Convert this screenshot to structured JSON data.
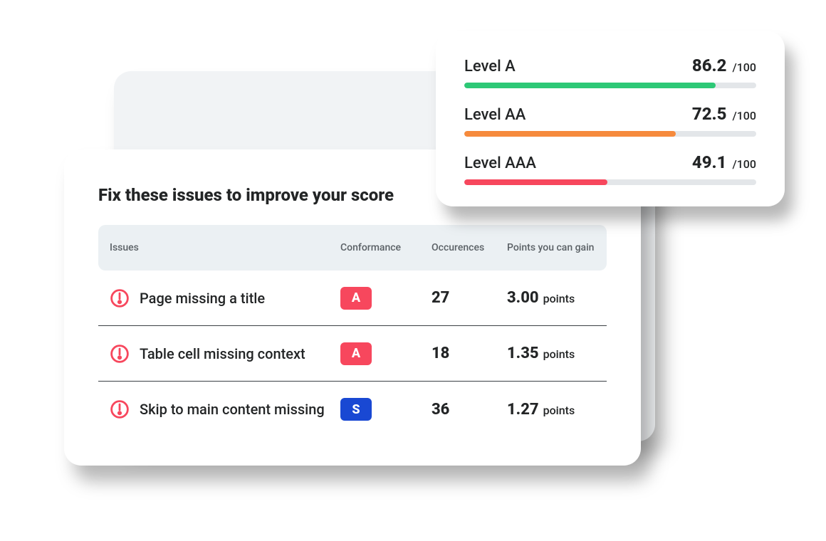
{
  "main": {
    "title": "Fix these issues to improve your score",
    "columns": {
      "issues": "Issues",
      "conformance": "Conformance",
      "occurrences": "Occurences",
      "points": "Points you can gain"
    },
    "points_unit": "points",
    "rows": [
      {
        "icon": "alert-icon",
        "issue": "Page missing a title",
        "conformance": "A",
        "conformance_color": "red",
        "occurrences": "27",
        "points": "3.00"
      },
      {
        "icon": "alert-icon",
        "issue": "Table cell missing context",
        "conformance": "A",
        "conformance_color": "red",
        "occurrences": "18",
        "points": "1.35"
      },
      {
        "icon": "alert-icon",
        "issue": "Skip to main content missing",
        "conformance": "S",
        "conformance_color": "blue",
        "occurrences": "36",
        "points": "1.27"
      }
    ]
  },
  "scores": {
    "max_label": "/100",
    "items": [
      {
        "label": "Level A",
        "value": "86.2",
        "percent": 86.2,
        "color": "green"
      },
      {
        "label": "Level AA",
        "value": "72.5",
        "percent": 72.5,
        "color": "orange"
      },
      {
        "label": "Level AAA",
        "value": "49.1",
        "percent": 49.1,
        "color": "pink"
      }
    ]
  }
}
